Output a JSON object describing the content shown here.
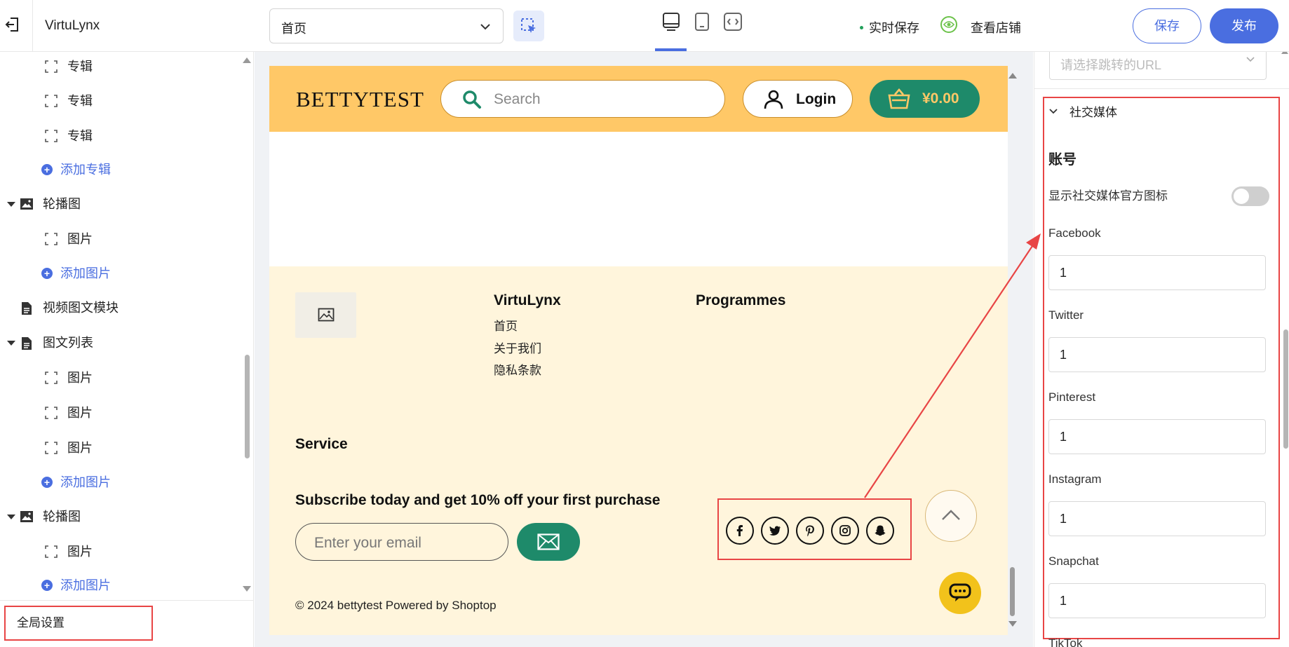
{
  "topbar": {
    "app_title": "VirtuLynx",
    "page_select_value": "首页",
    "autosave_label": "实时保存",
    "view_store_label": "查看店铺",
    "save_label": "保存",
    "publish_label": "发布"
  },
  "sidebar": {
    "items": [
      {
        "kind": "child",
        "label": "专辑",
        "icon": "frame-icon"
      },
      {
        "kind": "child",
        "label": "专辑",
        "icon": "frame-icon"
      },
      {
        "kind": "child",
        "label": "专辑",
        "icon": "frame-icon"
      },
      {
        "kind": "add",
        "label": "添加专辑",
        "icon": "plus-circle-icon"
      },
      {
        "kind": "section",
        "label": "轮播图",
        "icon": "image-icon"
      },
      {
        "kind": "child",
        "label": "图片",
        "icon": "frame-icon"
      },
      {
        "kind": "add",
        "label": "添加图片",
        "icon": "plus-circle-icon"
      },
      {
        "kind": "section-nocaret",
        "label": "视频图文模块",
        "icon": "document-icon"
      },
      {
        "kind": "section",
        "label": "图文列表",
        "icon": "document-icon"
      },
      {
        "kind": "child",
        "label": "图片",
        "icon": "frame-icon"
      },
      {
        "kind": "child",
        "label": "图片",
        "icon": "frame-icon"
      },
      {
        "kind": "child",
        "label": "图片",
        "icon": "frame-icon"
      },
      {
        "kind": "add",
        "label": "添加图片",
        "icon": "plus-circle-icon"
      },
      {
        "kind": "section",
        "label": "轮播图",
        "icon": "image-icon"
      },
      {
        "kind": "child",
        "label": "图片",
        "icon": "frame-icon"
      },
      {
        "kind": "add",
        "label": "添加图片",
        "icon": "plus-circle-icon"
      }
    ],
    "global_settings_label": "全局设置"
  },
  "store": {
    "brand": "BETTYTEST",
    "search_placeholder": "Search",
    "login_label": "Login",
    "cart_amount": "¥0.00",
    "colors": {
      "header": "#ffc867",
      "accent": "#1e8a6a",
      "footer": "#fff5dc"
    },
    "footer": {
      "col1_title": "VirtuLynx",
      "col1_links": [
        "首页",
        "关于我们",
        "隐私条款"
      ],
      "col2_title": "Programmes",
      "service_title": "Service",
      "subscribe_text": "Subscribe today and get 10% off your first purchase",
      "email_placeholder": "Enter your email",
      "social_icons": [
        "facebook-icon",
        "twitter-icon",
        "pinterest-icon",
        "instagram-icon",
        "snapchat-icon"
      ],
      "copyright": "© 2024 bettytest   Powered by Shoptop"
    }
  },
  "right_panel": {
    "url_placeholder": "请选择跳转的URL",
    "section_title": "社交媒体",
    "account_heading": "账号",
    "show_icons_label": "显示社交媒体官方图标",
    "show_icons_enabled": false,
    "fields": [
      {
        "label": "Facebook",
        "value": "1"
      },
      {
        "label": "Twitter",
        "value": "1"
      },
      {
        "label": "Pinterest",
        "value": "1"
      },
      {
        "label": "Instagram",
        "value": "1"
      },
      {
        "label": "Snapchat",
        "value": "1"
      }
    ],
    "next_field_label": "TikTok"
  },
  "annotation_color": "#e84545"
}
